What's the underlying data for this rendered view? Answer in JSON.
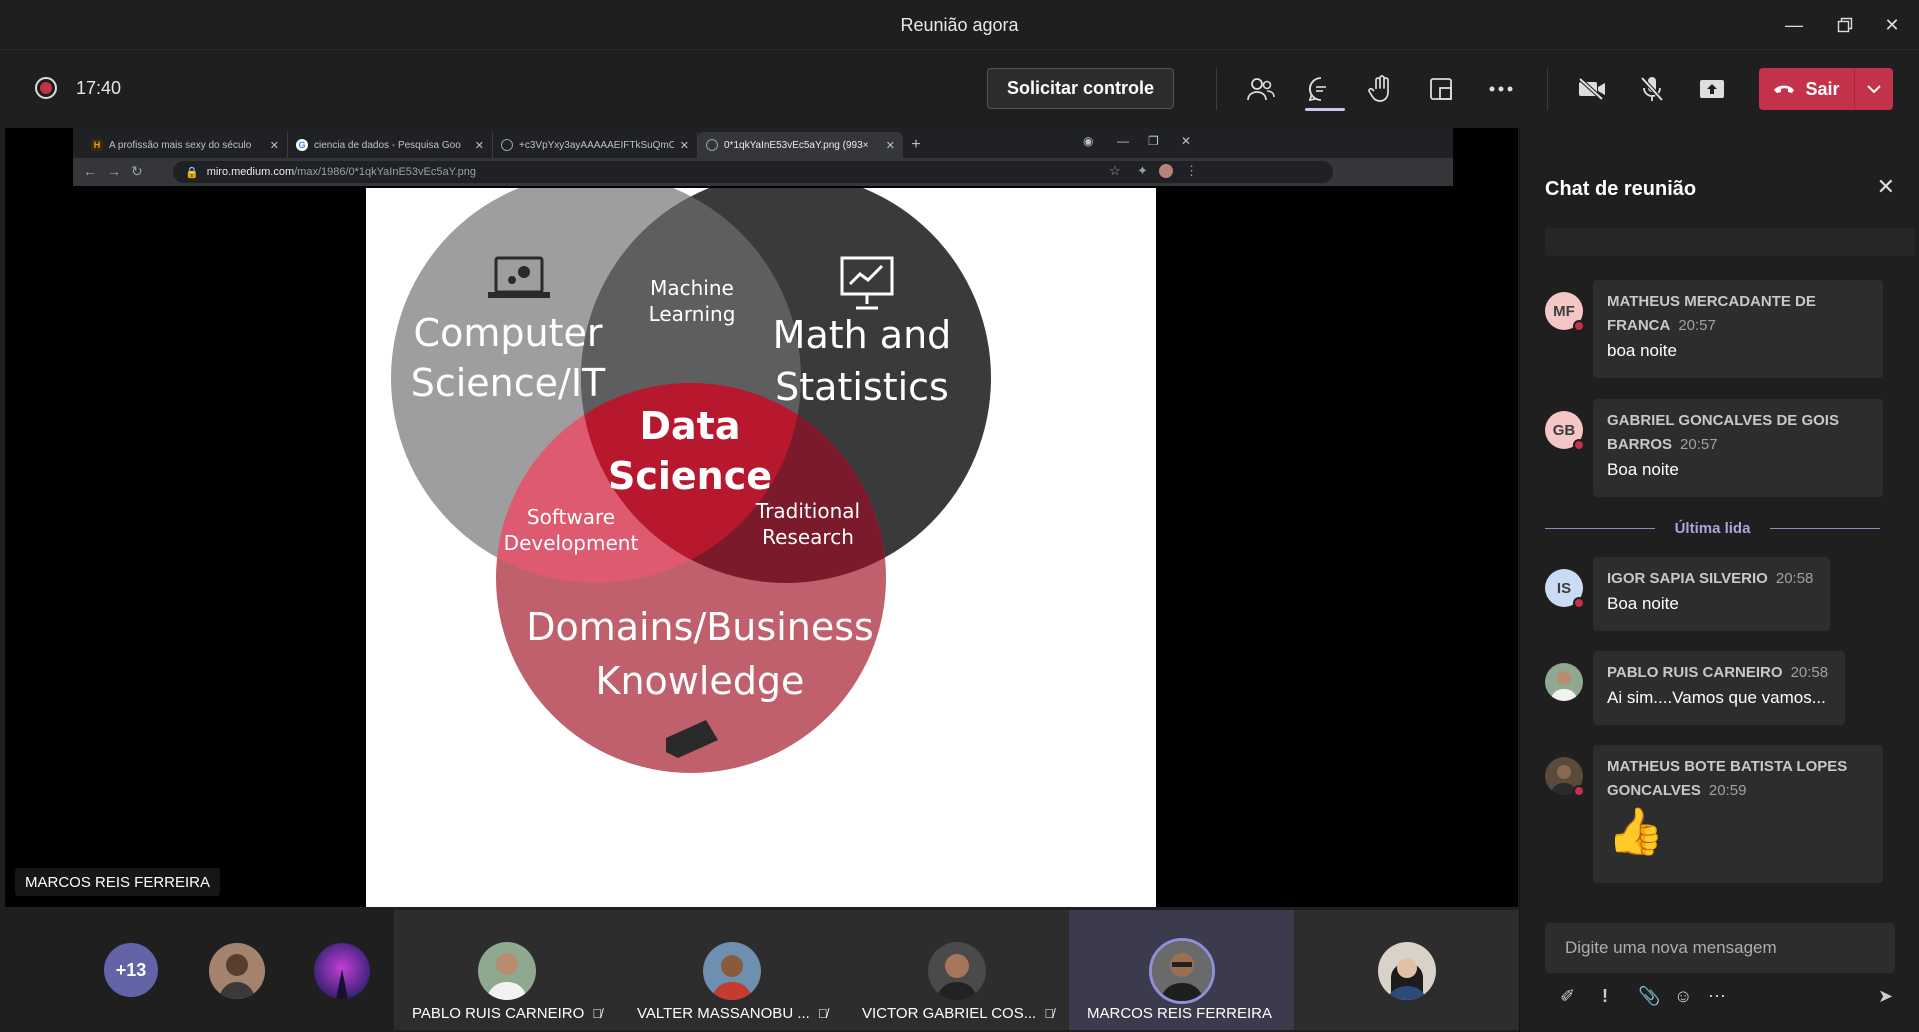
{
  "window": {
    "title": "Reunião agora"
  },
  "toolbar": {
    "timer": "17:40",
    "request_control": "Solicitar controle",
    "leave_label": "Sair"
  },
  "browser": {
    "tabs": [
      {
        "title": "A profissão mais sexy do século",
        "favicon": "H"
      },
      {
        "title": "ciencia de dados - Pesquisa Goo",
        "favicon": "G"
      },
      {
        "title": "+c3VpYxy3ayAAAAAEIFTkSuQmC",
        "favicon": "globe"
      },
      {
        "title": "0*1qkYaInE53vEc5aY.png (993×",
        "favicon": "globe"
      }
    ],
    "url_host": "miro.medium.com",
    "url_path": "/max/1986/0*1qkYaInE53vEc5aY.png"
  },
  "slide": {
    "computer_science": [
      "Computer",
      "Science/IT"
    ],
    "math_stats": [
      "Math and",
      "Statistics"
    ],
    "machine_learning": [
      "Machine",
      "Learning"
    ],
    "data_science": [
      "Data",
      "Science"
    ],
    "software_dev": [
      "Software",
      "Development"
    ],
    "traditional_research": [
      "Traditional",
      "Research"
    ],
    "domains": [
      "Domains/Business",
      "Knowledge"
    ]
  },
  "presenter_name": "MARCOS REIS FERREIRA",
  "participants": {
    "more_count": "+13",
    "tiles": [
      {
        "name": "PABLO RUIS CARNEIRO",
        "muted": true
      },
      {
        "name": "VALTER MASSANOBU ...",
        "muted": true
      },
      {
        "name": "VICTOR GABRIEL COS...",
        "muted": true
      },
      {
        "name": "MARCOS REIS FERREIRA",
        "muted": false
      }
    ]
  },
  "chat": {
    "title": "Chat de reunião",
    "last_read": "Última lida",
    "compose_placeholder": "Digite uma nova mensagem",
    "messages": [
      {
        "initials": "MF",
        "author_line1": "MATHEUS MERCADANTE DE",
        "author_line2": "FRANCA",
        "time": "20:57",
        "text": "boa noite"
      },
      {
        "initials": "GB",
        "author_line1": "GABRIEL GONCALVES DE GOIS",
        "author_line2": "BARROS",
        "time": "20:57",
        "text": "Boa noite"
      },
      {
        "initials": "IS",
        "author_line1": "IGOR SAPIA SILVERIO",
        "time": "20:58",
        "text": "Boa noite"
      },
      {
        "initials": "",
        "author_line1": "PABLO RUIS CARNEIRO",
        "time": "20:58",
        "text": "Ai sim....Vamos que vamos..."
      },
      {
        "initials": "",
        "author_line1": "MATHEUS BOTE BATISTA LOPES",
        "author_line2": "GONCALVES",
        "time": "20:59",
        "text": "👍"
      }
    ]
  },
  "colors": {
    "accent": "#6264a7",
    "leave": "#c4314b",
    "background": "#1f1f1f"
  }
}
